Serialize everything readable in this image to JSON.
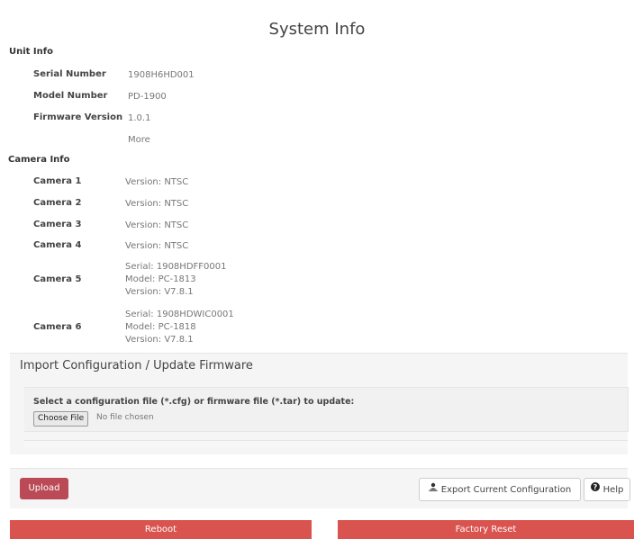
{
  "page_title": "System Info",
  "unit_info": {
    "heading": "Unit Info",
    "rows": [
      {
        "label": "Serial Number",
        "value": "1908H6HD001"
      },
      {
        "label": "Model Number",
        "value": "PD-1900"
      },
      {
        "label": "Firmware Version",
        "value": "1.0.1"
      }
    ],
    "more_link": "More"
  },
  "camera_info": {
    "heading": "Camera Info",
    "cameras": [
      {
        "label": "Camera 1",
        "lines": [
          "Version: NTSC"
        ]
      },
      {
        "label": "Camera 2",
        "lines": [
          "Version: NTSC"
        ]
      },
      {
        "label": "Camera 3",
        "lines": [
          "Version: NTSC"
        ]
      },
      {
        "label": "Camera 4",
        "lines": [
          "Version: NTSC"
        ]
      },
      {
        "label": "Camera 5",
        "lines": [
          "Serial: 1908HDFF0001",
          "Model: PC-1813",
          "Version: V7.8.1"
        ]
      },
      {
        "label": "Camera 6",
        "lines": [
          "Serial: 1908HDWIC0001",
          "Model: PC-1818",
          "Version: V7.8.1"
        ]
      }
    ]
  },
  "import_section": {
    "title": "Import Configuration / Update Firmware",
    "instruction": "Select a configuration file (*.cfg) or firmware file (*.tar) to update:",
    "choose_file_label": "Choose File",
    "no_file_text": "No file chosen"
  },
  "actions": {
    "upload_label": "Upload",
    "export_label": "Export Current Configuration",
    "export_icon": "export-icon",
    "help_label": "Help",
    "help_icon": "question-circle-icon",
    "reboot_label": "Reboot",
    "factory_reset_label": "Factory Reset"
  },
  "colors": {
    "upload": "#b94a56",
    "danger": "#d9534f"
  }
}
